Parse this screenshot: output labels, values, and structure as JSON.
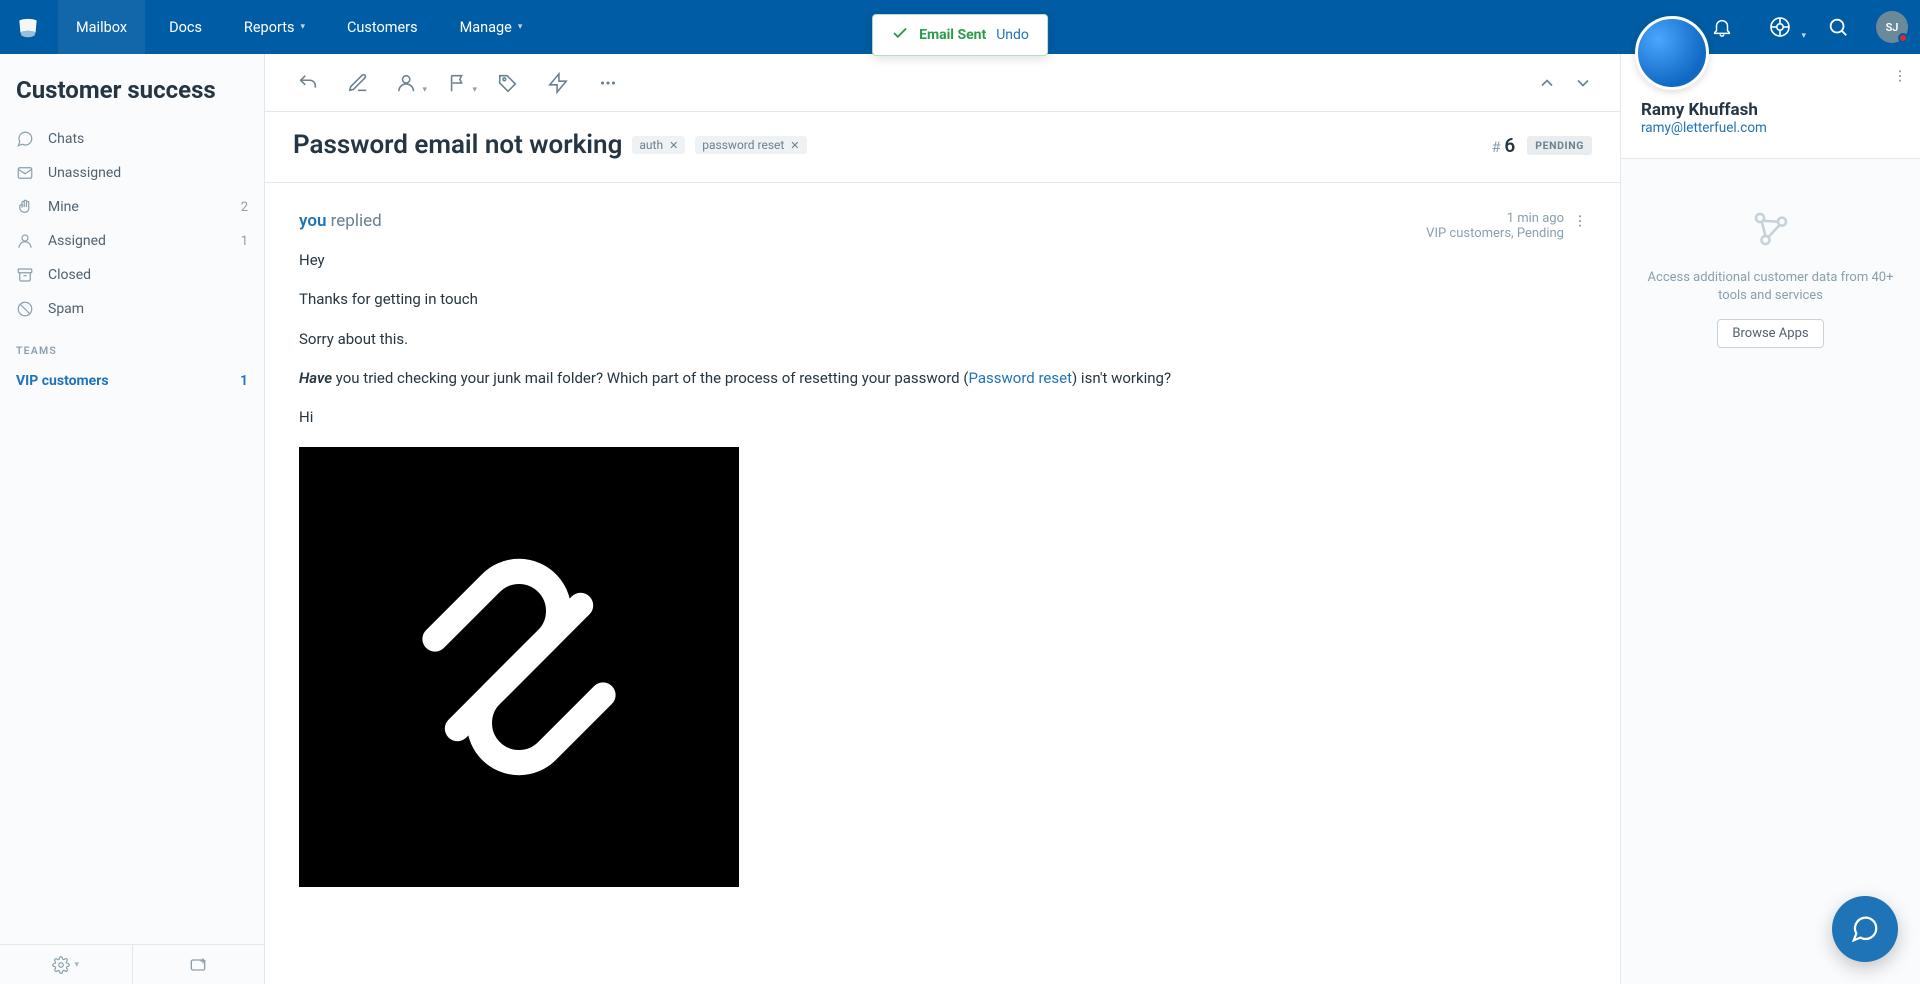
{
  "nav": {
    "items": [
      "Mailbox",
      "Docs",
      "Reports",
      "Customers",
      "Manage"
    ],
    "avatar": "SJ"
  },
  "toast": {
    "text": "Email Sent",
    "undo": "Undo"
  },
  "sidebar": {
    "title": "Customer success",
    "folders": [
      {
        "label": "Chats",
        "count": ""
      },
      {
        "label": "Unassigned",
        "count": ""
      },
      {
        "label": "Mine",
        "count": "2"
      },
      {
        "label": "Assigned",
        "count": "1"
      },
      {
        "label": "Closed",
        "count": ""
      },
      {
        "label": "Spam",
        "count": ""
      }
    ],
    "teams_label": "TEAMS",
    "team": {
      "label": "VIP customers",
      "count": "1"
    }
  },
  "conversation": {
    "subject": "Password email not working",
    "tags": [
      "auth",
      "password reset"
    ],
    "num_prefix": "# ",
    "num": "6",
    "status": "PENDING"
  },
  "message": {
    "from_who": "you",
    "from_action": "replied",
    "time": "1 min ago",
    "meta2": "VIP customers, Pending",
    "p1": "Hey",
    "p2": "Thanks for getting in touch",
    "p3": "Sorry about this.",
    "p4_lead": "Have",
    "p4_mid": " you tried checking your junk mail folder? Which part of the process of resetting your password (",
    "p4_link": "Password reset",
    "p4_tail": ") isn't working?",
    "p5": "Hi"
  },
  "customer": {
    "name": "Ramy Khuffash",
    "email": "ramy@letterfuel.com"
  },
  "apps": {
    "text": "Access additional customer data from 40+ tools and services",
    "button": "Browse Apps"
  }
}
